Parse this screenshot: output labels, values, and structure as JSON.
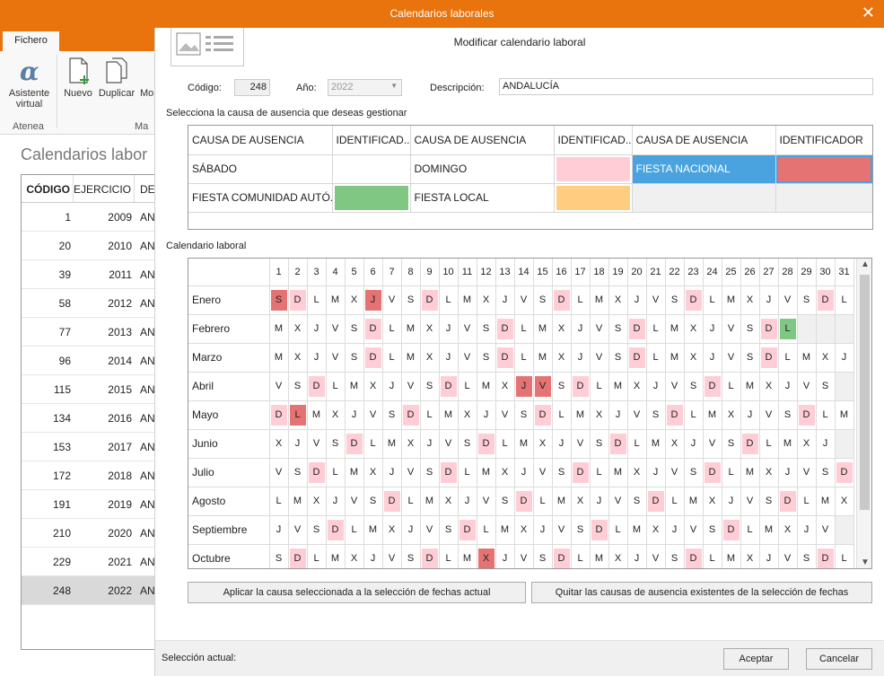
{
  "window": {
    "title": "Calendarios laborales"
  },
  "ribbon": {
    "tab": "Fichero",
    "asistente_label": "Asistente virtual",
    "nuevo_label": "Nuevo",
    "duplicar_label": "Duplicar",
    "modificar_partial": "Mo",
    "group_atenea": "Atenea",
    "group_partial": "Ma"
  },
  "background_grid": {
    "title": "Calendarios labor",
    "columns": [
      "CÓDIGO",
      "EJERCICIO",
      "DE"
    ],
    "rows": [
      {
        "codigo": "1",
        "ejercicio": "2009",
        "desc": "AN"
      },
      {
        "codigo": "20",
        "ejercicio": "2010",
        "desc": "AN"
      },
      {
        "codigo": "39",
        "ejercicio": "2011",
        "desc": "AN"
      },
      {
        "codigo": "58",
        "ejercicio": "2012",
        "desc": "AN"
      },
      {
        "codigo": "77",
        "ejercicio": "2013",
        "desc": "AN"
      },
      {
        "codigo": "96",
        "ejercicio": "2014",
        "desc": "AN"
      },
      {
        "codigo": "115",
        "ejercicio": "2015",
        "desc": "AN"
      },
      {
        "codigo": "134",
        "ejercicio": "2016",
        "desc": "AN"
      },
      {
        "codigo": "153",
        "ejercicio": "2017",
        "desc": "AN"
      },
      {
        "codigo": "172",
        "ejercicio": "2018",
        "desc": "AN"
      },
      {
        "codigo": "191",
        "ejercicio": "2019",
        "desc": "AN"
      },
      {
        "codigo": "210",
        "ejercicio": "2020",
        "desc": "AN"
      },
      {
        "codigo": "229",
        "ejercicio": "2021",
        "desc": "AN"
      },
      {
        "codigo": "248",
        "ejercicio": "2022",
        "desc": "AN",
        "selected": true
      }
    ]
  },
  "dialog": {
    "title": "Modificar calendario laboral",
    "codigo_label": "Código:",
    "codigo_value": "248",
    "anio_label": "Año:",
    "anio_value": "2022",
    "descripcion_label": "Descripción:",
    "descripcion_value": "ANDALUCÍA",
    "causes_section": "Selecciona la causa de ausencia que deseas gestionar",
    "causes_headers": [
      "CAUSA DE AUSENCIA",
      "IDENTIFICAD...",
      "CAUSA DE AUSENCIA",
      "IDENTIFICAD...",
      "CAUSA DE AUSENCIA",
      "IDENTIFICADOR"
    ],
    "causes": [
      {
        "name": "SÁBADO",
        "color": "#ffffff"
      },
      {
        "name": "DOMINGO",
        "color": "#ffcdd5"
      },
      {
        "name": "FIESTA NACIONAL",
        "color": "#e57373",
        "selected": true
      },
      {
        "name": "FIESTA COMUNIDAD AUTÓ...",
        "color": "#81c784"
      },
      {
        "name": "FIESTA LOCAL",
        "color": "#ffcc80"
      }
    ],
    "calendar_section": "Calendario laboral",
    "apply_button": "Aplicar la causa seleccionada a la selección de fechas actual",
    "remove_button": "Quitar las causas de ausencia existentes de la selección de fechas",
    "seleccion_label": "Selección actual:",
    "accept_button": "Aceptar",
    "cancel_button": "Cancelar"
  },
  "calendar": {
    "colors": {
      "domingo": "#ffcdd5",
      "nacional": "#e57373",
      "autonomica": "#81c784",
      "local": "#ffcc80"
    },
    "days": [
      "1",
      "2",
      "3",
      "4",
      "5",
      "6",
      "7",
      "8",
      "9",
      "10",
      "11",
      "12",
      "13",
      "14",
      "15",
      "16",
      "17",
      "18",
      "19",
      "20",
      "21",
      "22",
      "23",
      "24",
      "25",
      "26",
      "27",
      "28",
      "29",
      "30",
      "31"
    ],
    "months": [
      {
        "name": "Enero",
        "days": [
          "S",
          "D",
          "L",
          "M",
          "X",
          "J",
          "V",
          "S",
          "D",
          "L",
          "M",
          "X",
          "J",
          "V",
          "S",
          "D",
          "L",
          "M",
          "X",
          "J",
          "V",
          "S",
          "D",
          "L",
          "M",
          "X",
          "J",
          "V",
          "S",
          "D",
          "L"
        ],
        "marks": {
          "1": "nacional",
          "2": "domingo",
          "6": "nacional",
          "9": "domingo",
          "16": "domingo",
          "23": "domingo",
          "30": "domingo"
        }
      },
      {
        "name": "Febrero",
        "days": [
          "M",
          "X",
          "J",
          "V",
          "S",
          "D",
          "L",
          "M",
          "X",
          "J",
          "V",
          "S",
          "D",
          "L",
          "M",
          "X",
          "J",
          "V",
          "S",
          "D",
          "L",
          "M",
          "X",
          "J",
          "V",
          "S",
          "D",
          "L"
        ],
        "marks": {
          "6": "domingo",
          "13": "domingo",
          "20": "domingo",
          "27": "domingo",
          "28": "autonomica"
        }
      },
      {
        "name": "Marzo",
        "days": [
          "M",
          "X",
          "J",
          "V",
          "S",
          "D",
          "L",
          "M",
          "X",
          "J",
          "V",
          "S",
          "D",
          "L",
          "M",
          "X",
          "J",
          "V",
          "S",
          "D",
          "L",
          "M",
          "X",
          "J",
          "V",
          "S",
          "D",
          "L",
          "M",
          "X",
          "J"
        ],
        "marks": {
          "6": "domingo",
          "13": "domingo",
          "20": "domingo",
          "27": "domingo"
        }
      },
      {
        "name": "Abril",
        "days": [
          "V",
          "S",
          "D",
          "L",
          "M",
          "X",
          "J",
          "V",
          "S",
          "D",
          "L",
          "M",
          "X",
          "J",
          "V",
          "S",
          "D",
          "L",
          "M",
          "X",
          "J",
          "V",
          "S",
          "D",
          "L",
          "M",
          "X",
          "J",
          "V",
          "S"
        ],
        "marks": {
          "3": "domingo",
          "10": "domingo",
          "14": "nacional",
          "15": "nacional",
          "17": "domingo",
          "24": "domingo"
        }
      },
      {
        "name": "Mayo",
        "days": [
          "D",
          "L",
          "M",
          "X",
          "J",
          "V",
          "S",
          "D",
          "L",
          "M",
          "X",
          "J",
          "V",
          "S",
          "D",
          "L",
          "M",
          "X",
          "J",
          "V",
          "S",
          "D",
          "L",
          "M",
          "X",
          "J",
          "V",
          "S",
          "D",
          "L",
          "M"
        ],
        "marks": {
          "1": "domingo",
          "2": "nacional",
          "8": "domingo",
          "15": "domingo",
          "22": "domingo",
          "29": "domingo"
        }
      },
      {
        "name": "Junio",
        "days": [
          "X",
          "J",
          "V",
          "S",
          "D",
          "L",
          "M",
          "X",
          "J",
          "V",
          "S",
          "D",
          "L",
          "M",
          "X",
          "J",
          "V",
          "S",
          "D",
          "L",
          "M",
          "X",
          "J",
          "V",
          "S",
          "D",
          "L",
          "M",
          "X",
          "J"
        ],
        "marks": {
          "5": "domingo",
          "12": "domingo",
          "19": "domingo",
          "26": "domingo"
        }
      },
      {
        "name": "Julio",
        "days": [
          "V",
          "S",
          "D",
          "L",
          "M",
          "X",
          "J",
          "V",
          "S",
          "D",
          "L",
          "M",
          "X",
          "J",
          "V",
          "S",
          "D",
          "L",
          "M",
          "X",
          "J",
          "V",
          "S",
          "D",
          "L",
          "M",
          "X",
          "J",
          "V",
          "S",
          "D"
        ],
        "marks": {
          "3": "domingo",
          "10": "domingo",
          "17": "domingo",
          "24": "domingo",
          "31": "domingo"
        }
      },
      {
        "name": "Agosto",
        "days": [
          "L",
          "M",
          "X",
          "J",
          "V",
          "S",
          "D",
          "L",
          "M",
          "X",
          "J",
          "V",
          "S",
          "D",
          "L",
          "M",
          "X",
          "J",
          "V",
          "S",
          "D",
          "L",
          "M",
          "X",
          "J",
          "V",
          "S",
          "D",
          "L",
          "M",
          "X"
        ],
        "marks": {
          "7": "domingo",
          "14": "domingo",
          "21": "domingo",
          "28": "domingo"
        }
      },
      {
        "name": "Septiembre",
        "days": [
          "J",
          "V",
          "S",
          "D",
          "L",
          "M",
          "X",
          "J",
          "V",
          "S",
          "D",
          "L",
          "M",
          "X",
          "J",
          "V",
          "S",
          "D",
          "L",
          "M",
          "X",
          "J",
          "V",
          "S",
          "D",
          "L",
          "M",
          "X",
          "J",
          "V"
        ],
        "marks": {
          "4": "domingo",
          "11": "domingo",
          "18": "domingo",
          "25": "domingo"
        }
      },
      {
        "name": "Octubre",
        "days": [
          "S",
          "D",
          "L",
          "M",
          "X",
          "J",
          "V",
          "S",
          "D",
          "L",
          "M",
          "X",
          "J",
          "V",
          "S",
          "D",
          "L",
          "M",
          "X",
          "J",
          "V",
          "S",
          "D",
          "L",
          "M",
          "X",
          "J",
          "V",
          "S",
          "D",
          "L"
        ],
        "marks": {
          "2": "domingo",
          "9": "domingo",
          "12": "nacional",
          "16": "domingo",
          "23": "domingo",
          "30": "domingo"
        }
      }
    ]
  }
}
